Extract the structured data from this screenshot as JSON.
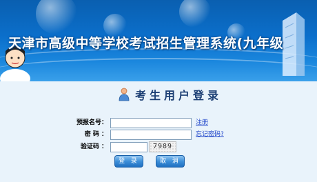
{
  "header": {
    "title": "天津市高级中等学校考试招生管理系统(九年级"
  },
  "login": {
    "title": "考生用户登录",
    "fields": {
      "reg_no_label": "预报名号：",
      "password_label": "密 码 ：",
      "captcha_label": "验证码 ："
    },
    "links": {
      "register": "注册",
      "forgot_password": "忘记密码?"
    },
    "captcha_text": "7989",
    "buttons": {
      "login": "登 录",
      "cancel": "取 消"
    }
  },
  "colors": {
    "banner": "#0b6fcb",
    "background": "#e9f3fb",
    "link": "#1d43c9",
    "button": "#3d8fd9"
  }
}
